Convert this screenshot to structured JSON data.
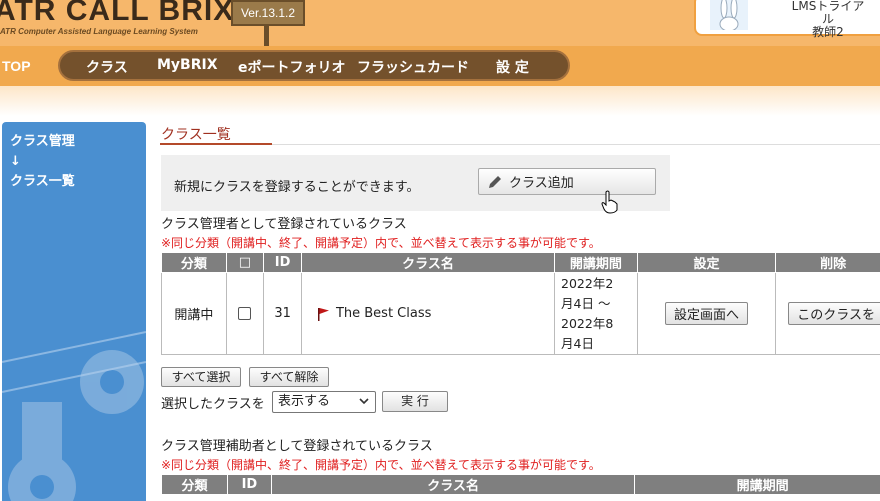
{
  "header": {
    "logo": "ATR CALL BRIX",
    "logo_sub": "ATR Computer Assisted Language Learning System",
    "version": "Ver.13.1.2",
    "user_line1": "LMSトライアル",
    "user_line2": "教師2"
  },
  "nav": {
    "top": "TOP",
    "items": [
      "クラス",
      "MyBRIX",
      "eポートフォリオ",
      "フラッシュカード",
      "設 定"
    ]
  },
  "sidebar": {
    "line1": "クラス管理",
    "arrow": "↓",
    "line2": "クラス一覧"
  },
  "main": {
    "title": "クラス一覧",
    "add_text": "新規にクラスを登録することができます。",
    "add_button": "クラス追加",
    "section1": "クラス管理者として登録されているクラス",
    "notice": "※同じ分類（開講中、終了、開講予定）内で、並べ替えて表示する事が可能です。",
    "table1": {
      "headers": [
        "分類",
        "□",
        "ID",
        "クラス名",
        "開講期間",
        "設定",
        "削除"
      ],
      "row": {
        "status": "開講中",
        "id": "31",
        "name": "The Best Class",
        "period_lines": [
          "2022年2",
          "月4日 ～",
          "2022年8",
          "月4日"
        ],
        "settings_btn": "設定画面へ",
        "delete_btn": "このクラスを"
      }
    },
    "select_all": "すべて選択",
    "deselect_all": "すべて解除",
    "selected_label": "選択したクラスを",
    "select_value": "表示する",
    "exec_button": "実 行",
    "section2": "クラス管理補助者として登録されているクラス",
    "notice2": "※同じ分類（開講中、終了、開講予定）内で、並べ替えて表示する事が可能です。",
    "table2": {
      "headers": [
        "分類",
        "ID",
        "クラス名",
        "開講期間"
      ]
    }
  },
  "colors": {
    "nav_bg": "#f1a94e",
    "nav_pill": "#74512c",
    "sidebar": "#4a8fd0",
    "notice": "#e02020",
    "table_header": "#7f7f7f"
  }
}
